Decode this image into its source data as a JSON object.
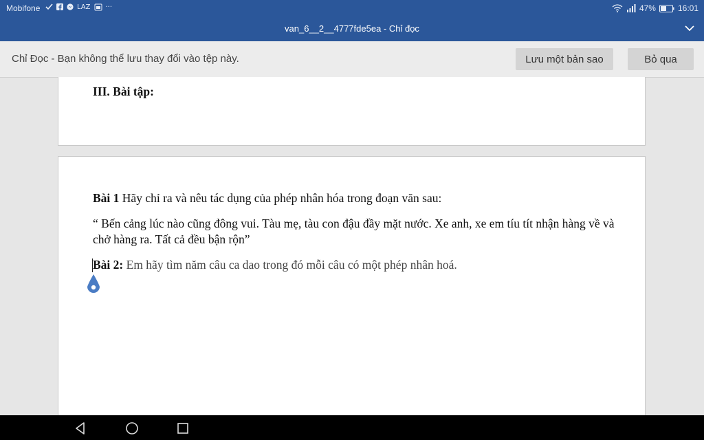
{
  "status_bar": {
    "carrier": "Mobifone",
    "notif_text": "LAZ",
    "more": "···",
    "battery": "47%",
    "time": "16:01"
  },
  "title_bar": {
    "title": "van_6__2__4777fde5ea - Chỉ đọc"
  },
  "banner": {
    "message": "Chỉ Đọc - Bạn không thể lưu thay đổi vào tệp này.",
    "save_copy_label": "Lưu một bản sao",
    "dismiss_label": "Bỏ qua"
  },
  "document": {
    "section_title": "III. Bài tập:",
    "ex1_label": "Bài 1",
    "ex1_text": " Hãy chỉ ra và nêu tác dụng của phép nhân hóa trong đoạn văn sau:",
    "ex1_quote": "“ Bến cảng lúc nào cũng đông vui. Tàu mẹ, tàu con đậu đầy mặt nước. Xe anh, xe em tíu tít nhận hàng về và chở hàng ra. Tất cả đều bận rộn”",
    "ex2_label": "Bài 2:",
    "ex2_text": " Em hãy tìm năm câu ca dao trong đó mỗi câu có một phép nhân hoá."
  },
  "colors": {
    "title_bar": "#2b579a",
    "banner_bg": "#ececec",
    "button_bg": "#d4d4d4",
    "cursor_handle": "#4a7cc4"
  },
  "icons": [
    "check-icon",
    "facebook-icon",
    "messenger-icon",
    "wifi-icon",
    "signal-icon",
    "battery-icon",
    "chevron-down-icon",
    "back-icon",
    "home-icon",
    "recents-icon",
    "cursor-handle-icon"
  ]
}
